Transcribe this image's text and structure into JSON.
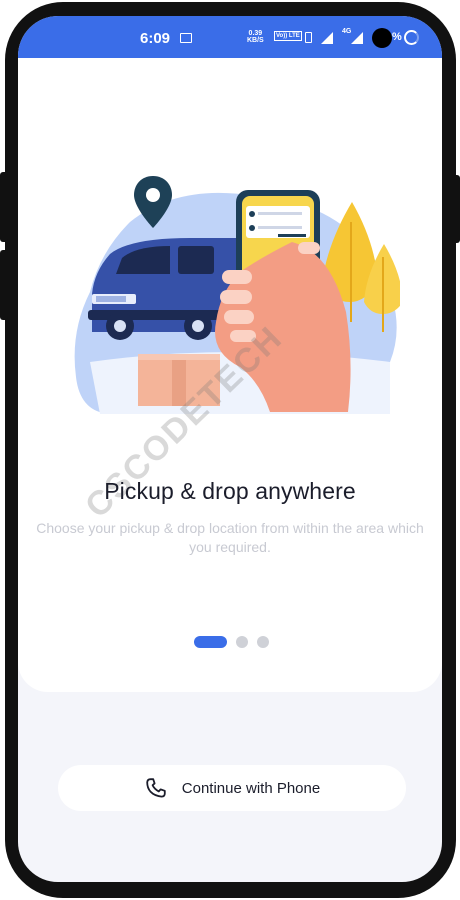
{
  "status_bar": {
    "time": "6:09",
    "net_speed_value": "0.39",
    "net_speed_unit": "KB/S",
    "volte": "Vo)) LTE",
    "network_type": "4G",
    "battery_pct": "%"
  },
  "onboarding": {
    "headline": "Pickup & drop anywhere",
    "description": "Choose your pickup & drop location from within the area which you required.",
    "page_count": 3,
    "current_page": 1
  },
  "actions": {
    "continue_phone_label": "Continue with Phone"
  },
  "watermark": "CSCODETECH",
  "colors": {
    "accent": "#3a6de8",
    "headline": "#1b1d2b",
    "muted_text": "#c8cad2",
    "background": "#f4f5fa"
  },
  "icons": [
    "image-icon",
    "vibrate-icon",
    "signal-icon",
    "battery-icon",
    "phone-icon",
    "location-pin-icon"
  ]
}
